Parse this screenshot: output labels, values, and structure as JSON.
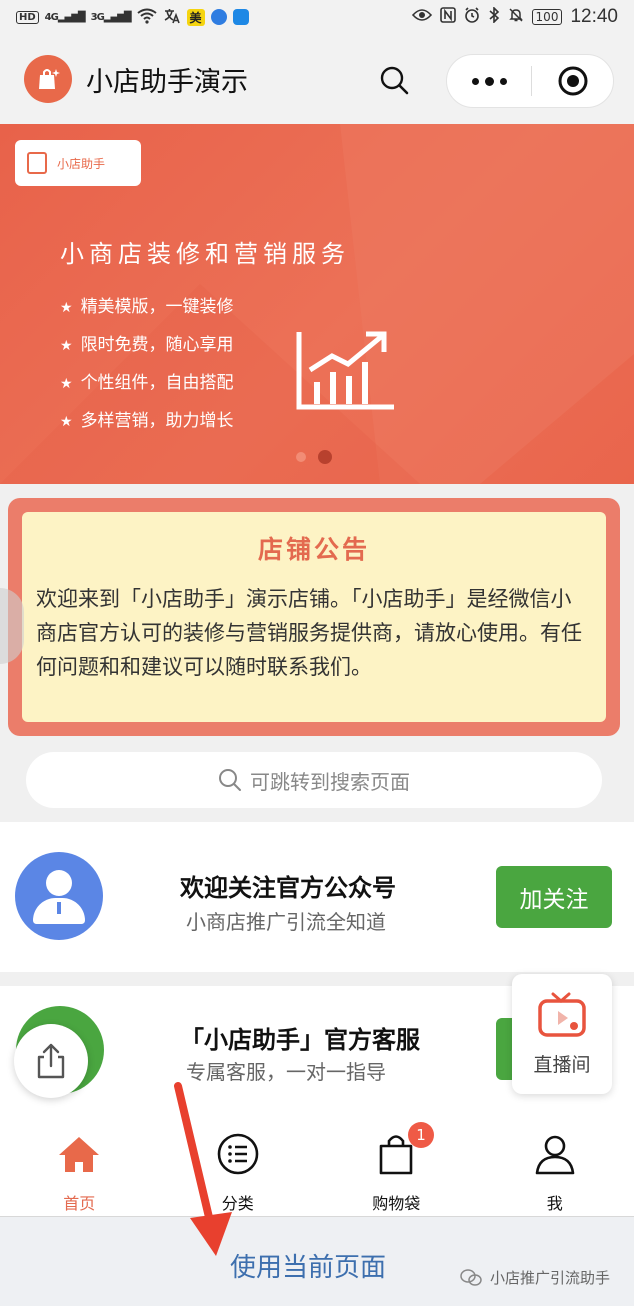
{
  "status_bar": {
    "left_items": [
      "HD",
      "4G",
      "3G"
    ],
    "mei_badge": "美",
    "battery": "100",
    "time": "12:40"
  },
  "nav": {
    "title": "小店助手演示"
  },
  "banner": {
    "tag_label": "小店助手",
    "title": "小商店装修和营销服务",
    "features": [
      "精美模版，一键装修",
      "限时免费，随心享用",
      "个性组件，自由搭配",
      "多样营销，助力增长"
    ],
    "slide_count": 2,
    "active_slide": 2
  },
  "notice": {
    "title": "店铺公告",
    "body": "欢迎来到「小店助手」演示店铺。「小店助手」是经微信小商店官方认可的装修与营销服务提供商，请放心使用。有任何问题和和建议可以随时联系我们。"
  },
  "search": {
    "placeholder": "可跳转到搜索页面"
  },
  "follow_card": {
    "title": "欢迎关注官方公众号",
    "subtitle": "小商店推广引流全知道",
    "button_label": "加关注"
  },
  "service_card": {
    "title": "「小店助手」官方客服",
    "subtitle": "专属客服，一对一指导"
  },
  "live_float": {
    "label": "直播间"
  },
  "tabs": [
    {
      "label": "首页",
      "icon": "home-icon",
      "active": true
    },
    {
      "label": "分类",
      "icon": "list-icon",
      "active": false
    },
    {
      "label": "购物袋",
      "icon": "bag-icon",
      "active": false
    },
    {
      "label": "我",
      "icon": "user-icon",
      "active": false
    }
  ],
  "cart_badge": "1",
  "bottom": {
    "use_page_label": "使用当前页面",
    "watermark": "小店推广引流助手"
  },
  "colors": {
    "brand": "#e8694a",
    "notice_bg": "#fdf3c5",
    "green": "#4aa640",
    "link": "#3d6fae"
  }
}
